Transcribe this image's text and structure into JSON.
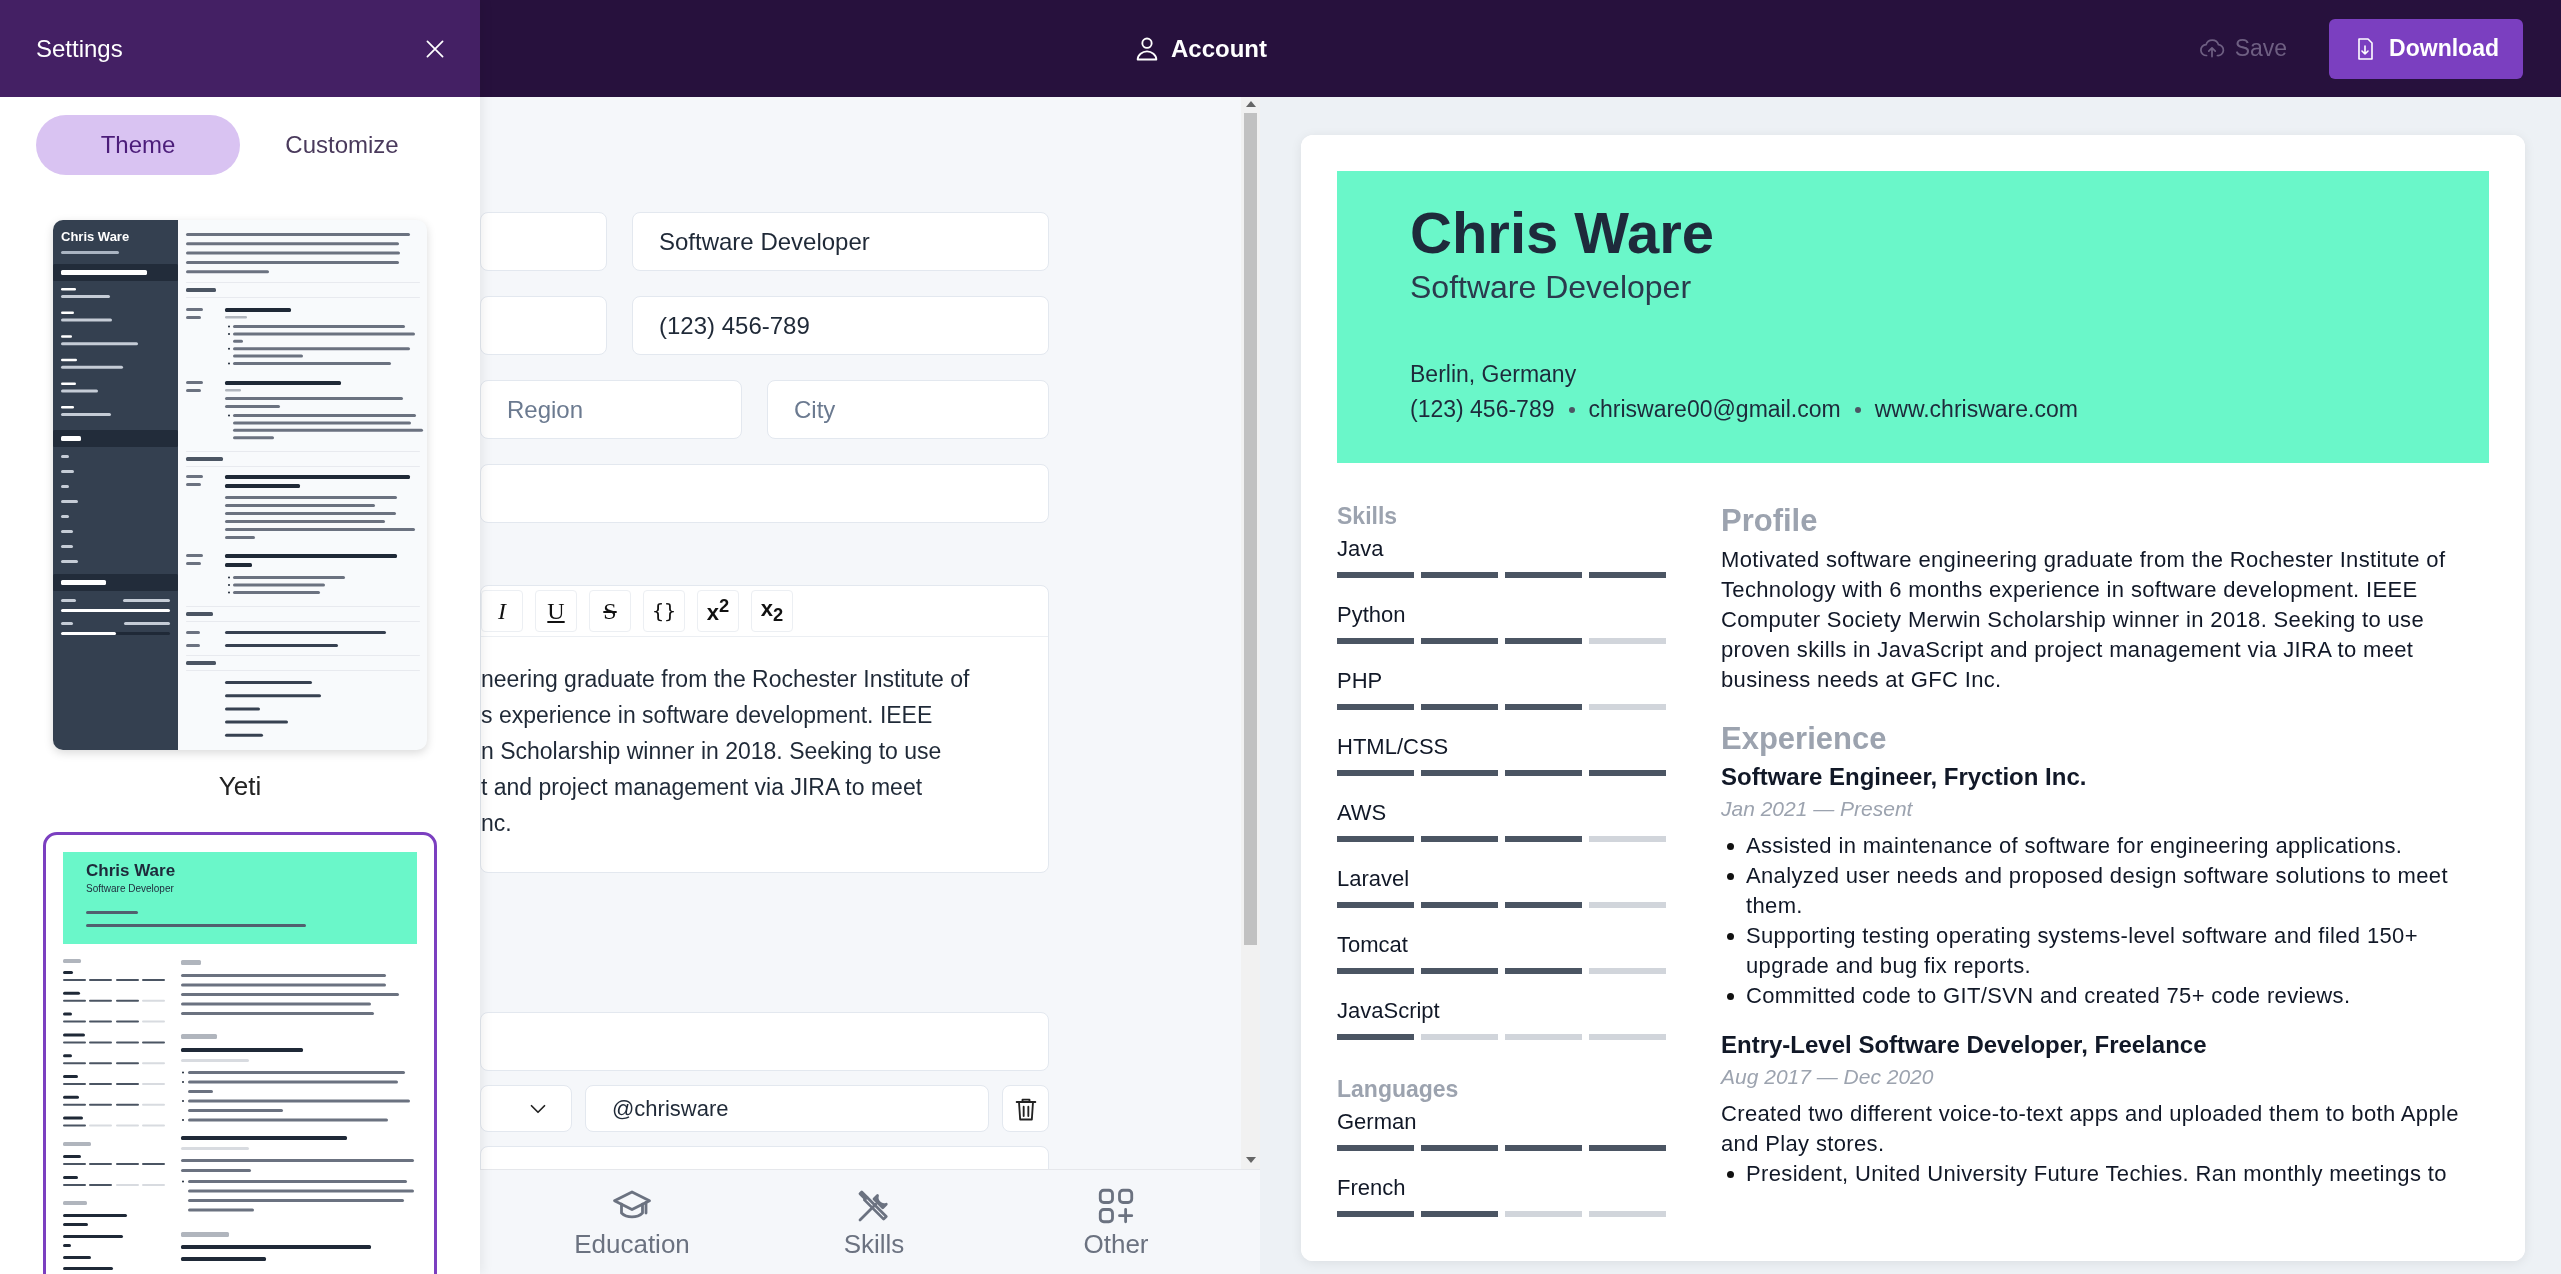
{
  "settings_panel": {
    "title": "Settings",
    "tabs": [
      {
        "label": "Theme",
        "selected": true
      },
      {
        "label": "Customize",
        "selected": false
      }
    ],
    "themes": [
      {
        "name": "Yeti",
        "selected": false,
        "preview": {
          "kind": "sidebar",
          "name": "Chris Ware"
        }
      },
      {
        "selected": true,
        "preview": {
          "kind": "banner",
          "name": "Chris Ware",
          "title": "Software Developer"
        }
      }
    ]
  },
  "top_bar": {
    "account": "Account",
    "save": {
      "label": "Save",
      "disabled": true
    },
    "download": "Download"
  },
  "editor": {
    "rows_before": [
      [
        {
          "kind": "input"
        },
        {
          "kind": "input",
          "value": "Software Developer"
        }
      ],
      [
        {
          "kind": "input"
        },
        {
          "kind": "input",
          "value": "(123) 456-789"
        }
      ],
      [
        {
          "kind": "input",
          "placeholder": "Region"
        },
        {
          "kind": "input",
          "placeholder": "City"
        }
      ],
      [
        {
          "kind": "input"
        }
      ]
    ],
    "rich_text": {
      "toolbar": [
        {
          "label": "I",
          "kind": "italic"
        },
        {
          "label": "U",
          "kind": "underline"
        },
        {
          "label": "S",
          "kind": "strike"
        },
        {
          "label": "{}",
          "kind": "code"
        },
        {
          "label": "x$^{2}$",
          "kind": "superscript"
        },
        {
          "label": "x$_{2}$",
          "kind": "subscript"
        }
      ],
      "lines": [
        "neering graduate from the Rochester Institute of",
        "s experience in software development. IEEE",
        "n Scholarship winner in 2018. Seeking to use",
        "t and project management via JIRA to meet",
        "nc."
      ]
    },
    "rows_after": [
      [
        {
          "kind": "input"
        }
      ],
      [
        {
          "kind": "select"
        },
        {
          "kind": "input",
          "value": "@chrisware"
        },
        {
          "kind": "delete"
        }
      ],
      [
        {
          "kind": "input"
        }
      ]
    ]
  },
  "bottom_nav": [
    {
      "label": "Education",
      "kind": "education"
    },
    {
      "label": "Skills",
      "kind": "skills"
    },
    {
      "label": "Other",
      "kind": "other"
    }
  ],
  "preview": {
    "kind": "banner",
    "name": "Chris Ware",
    "title": "Software Developer",
    "location": "Berlin, Germany",
    "contacts": [
      "(123) 456-789",
      "chrisware00@gmail.com",
      "www.chrisware.com"
    ],
    "left_sections": [
      {
        "heading": "Skills",
        "kind": "bars",
        "items": [
          {
            "name": "Java",
            "level": 1
          },
          {
            "name": "Python",
            "level": 0.75
          },
          {
            "name": "PHP",
            "level": 0.75
          },
          {
            "name": "HTML/CSS",
            "level": 1
          },
          {
            "name": "AWS",
            "level": 0.75
          },
          {
            "name": "Laravel",
            "level": 0.75
          },
          {
            "name": "Tomcat",
            "level": 0.75
          },
          {
            "name": "JavaScript",
            "level": 0.25
          }
        ]
      },
      {
        "heading": "Languages",
        "kind": "bars",
        "items": [
          {
            "name": "German",
            "level": 1
          },
          {
            "name": "French",
            "level": 0.5
          }
        ]
      }
    ],
    "right_sections": [
      {
        "heading": "Profile",
        "paragraphs": [
          "Motivated software engineering graduate from the Rochester Institute of Technology with 6 months experience in software development. IEEE Computer Society Merwin Scholarship winner in 2018. Seeking to use proven skills in JavaScript and project management via JIRA to meet business needs at GFC Inc."
        ]
      },
      {
        "heading": "Experience",
        "entries": [
          {
            "title": "Software Engineer, Fryction Inc.",
            "date": "Jan 2021 — Present",
            "bullets": [
              "Assisted in maintenance of software for engineering applications.",
              "Analyzed user needs and proposed design software solutions to meet them.",
              "Supporting testing operating systems-level software and filed 150+ upgrade and bug fix reports.",
              "Committed code to GIT/SVN and created 75+ code reviews."
            ]
          },
          {
            "title": "Entry-Level Software Developer, Freelance",
            "date": "Aug 2017 — Dec 2020",
            "paragraphs": [
              "Created two different voice-to-text apps and uploaded them to both Apple and Play stores."
            ],
            "bullets": [
              "President, United University Future Techies. Ran monthly meetings to"
            ]
          }
        ]
      }
    ]
  }
}
